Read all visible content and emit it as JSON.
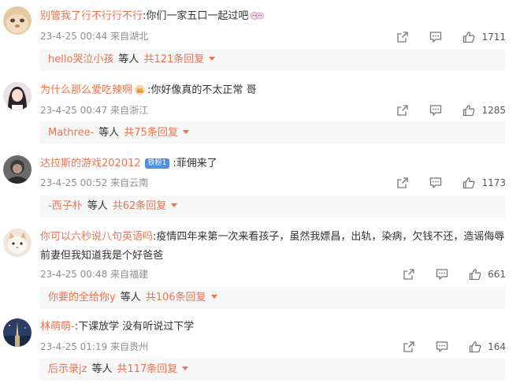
{
  "comments": [
    {
      "username": "别管我了行不行行不行",
      "text": ":你们一家五口一起过吧",
      "time": "23-4-25 00:44",
      "location": "来自湖北",
      "likes": "1711",
      "reply_user": "hello哭泣小孩",
      "reply_mid": "等人",
      "reply_count": "共121条回复"
    },
    {
      "username": "为什么那么爱吃辣啊",
      "text": ":你好像真的不太正常 哥",
      "time": "23-4-25 00:47",
      "location": "来自浙江",
      "likes": "1285",
      "reply_user": "Mathree-",
      "reply_mid": "等人",
      "reply_count": "共75条回复"
    },
    {
      "username": "达拉斯的游戏202012",
      "badge": "铁粉1",
      "text": ":菲佣来了",
      "time": "23-4-25 00:52",
      "location": "来自云南",
      "likes": "1173",
      "reply_user": "-西子朴",
      "reply_mid": "等人",
      "reply_count": "共62条回复"
    },
    {
      "username": "你可以六秒说八句英语吗",
      "text": ":疫情四年来第一次来看孩子，虽然我嫖昌，出轨，染病，欠钱不还，造谣侮辱前妻但我知道我是个好爸爸",
      "time": "23-4-25 00:48",
      "location": "来自福建",
      "likes": "661",
      "reply_user": "你要的全给你y",
      "reply_mid": "等人",
      "reply_count": "共106条回复"
    },
    {
      "username": "林萌萌-",
      "text": ":下课放学 没有听说过下学",
      "time": "23-4-25 01:19",
      "location": "来自贵州",
      "likes": "164",
      "reply_user": "后示录jz",
      "reply_mid": "等人",
      "reply_count": "共117条回复"
    }
  ],
  "colors": {
    "username": "#eb7350",
    "meta": "#8f8f8f",
    "reply_bg": "#f7f7f7",
    "badge": "#4e8ee6"
  },
  "icons": {
    "share": "share-icon",
    "comment": "comment-icon",
    "like": "thumbs-up-icon"
  }
}
